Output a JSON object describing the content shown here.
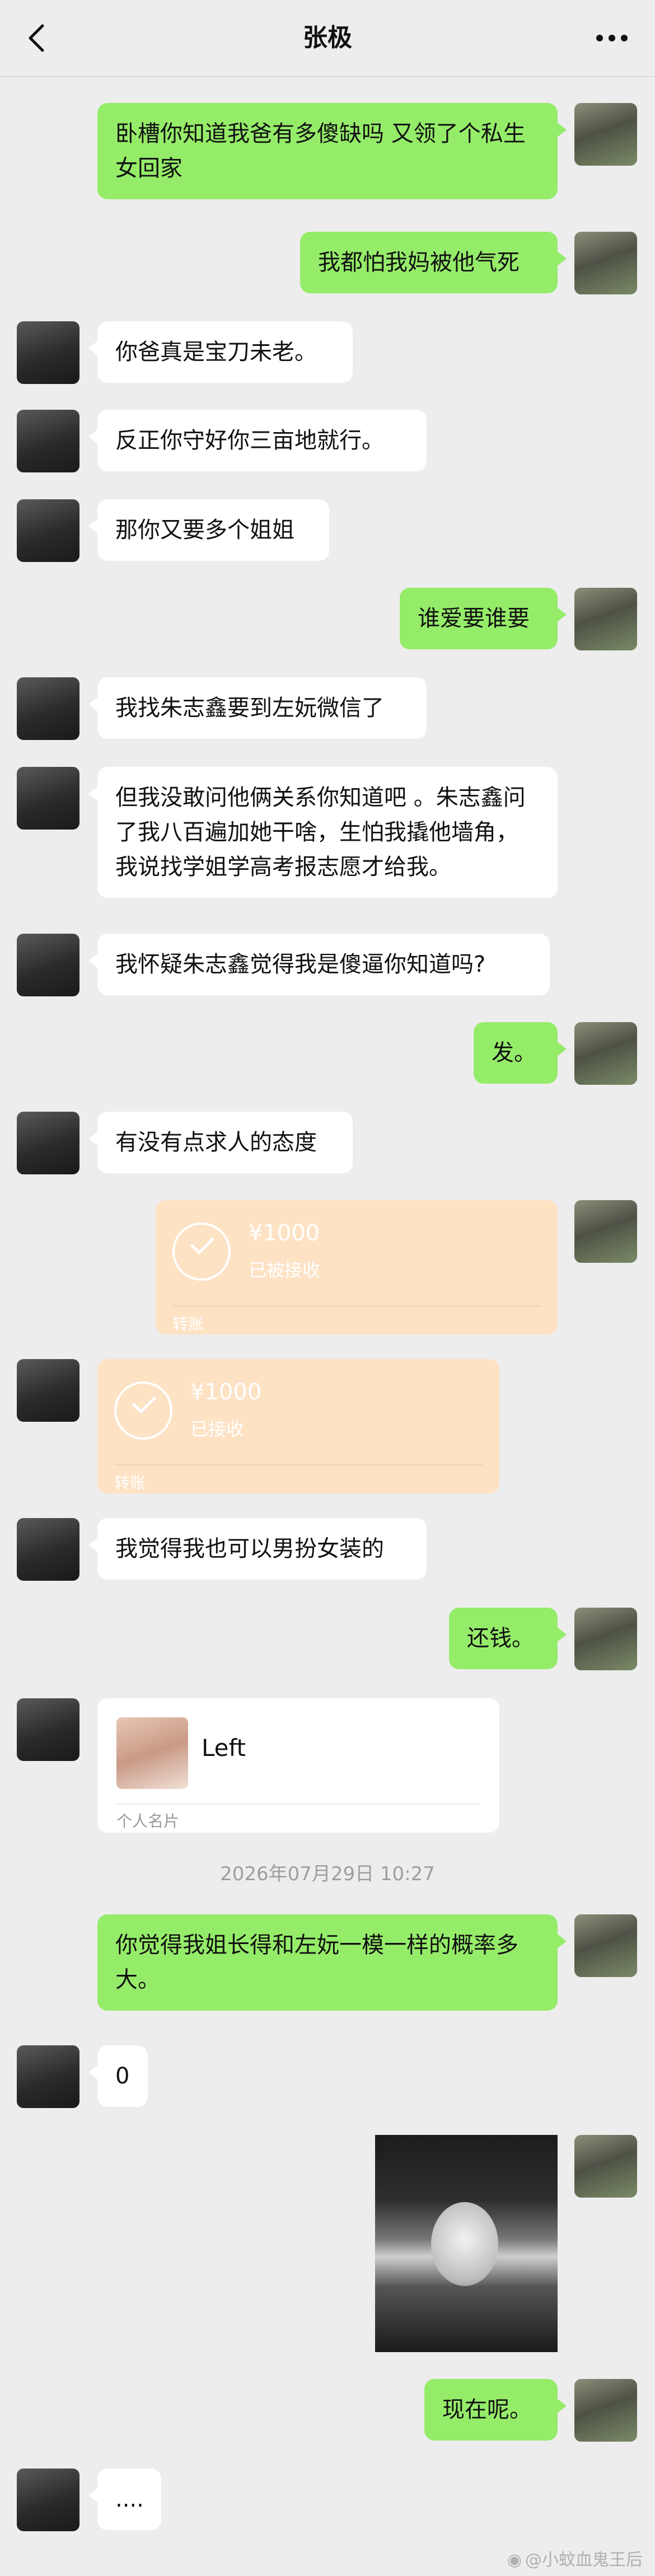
{
  "header": {
    "title": "张极"
  },
  "messages": {
    "m1": "卧槽你知道我爸有多傻缺吗 又领了个私生女回家",
    "m2": "我都怕我妈被他气死",
    "m3": "你爸真是宝刀未老。",
    "m4": "反正你守好你三亩地就行。",
    "m5": "那你又要多个姐姐",
    "m6": "谁爱要谁要",
    "m7": "我找朱志鑫要到左妧微信了",
    "m8": "但我没敢问他俩关系你知道吧 。朱志鑫问了我八百遍加她干啥，生怕我撬他墙角，我说找学姐学高考报志愿才给我。",
    "m9": "我怀疑朱志鑫觉得我是傻逼你知道吗?",
    "m10": "发。",
    "m11": "有没有点求人的态度",
    "m14": "我觉得我也可以男扮女装的",
    "m15": "还钱。",
    "m18": "你觉得我姐长得和左妧一模一样的概率多大。",
    "m19": "0",
    "m21": "现在呢。",
    "m22": "...."
  },
  "transfer_1": {
    "amount": "¥1000",
    "status": "已被接收",
    "footer": "转账"
  },
  "transfer_2": {
    "amount": "¥1000",
    "status": "已接收",
    "footer": "转账"
  },
  "contact_card": {
    "name": "Left",
    "footer": "个人名片"
  },
  "timestamp": "2026年07月29日 10:27",
  "watermark": "@小蚊血鬼王后",
  "icons": {
    "back": "chevron-left-icon",
    "more": "more-dots-icon",
    "check": "check-circle-icon"
  },
  "colors": {
    "background": "#ededed",
    "sent_bubble": "#95ec69",
    "received_bubble": "#ffffff",
    "transfer": "#fde2c4"
  }
}
